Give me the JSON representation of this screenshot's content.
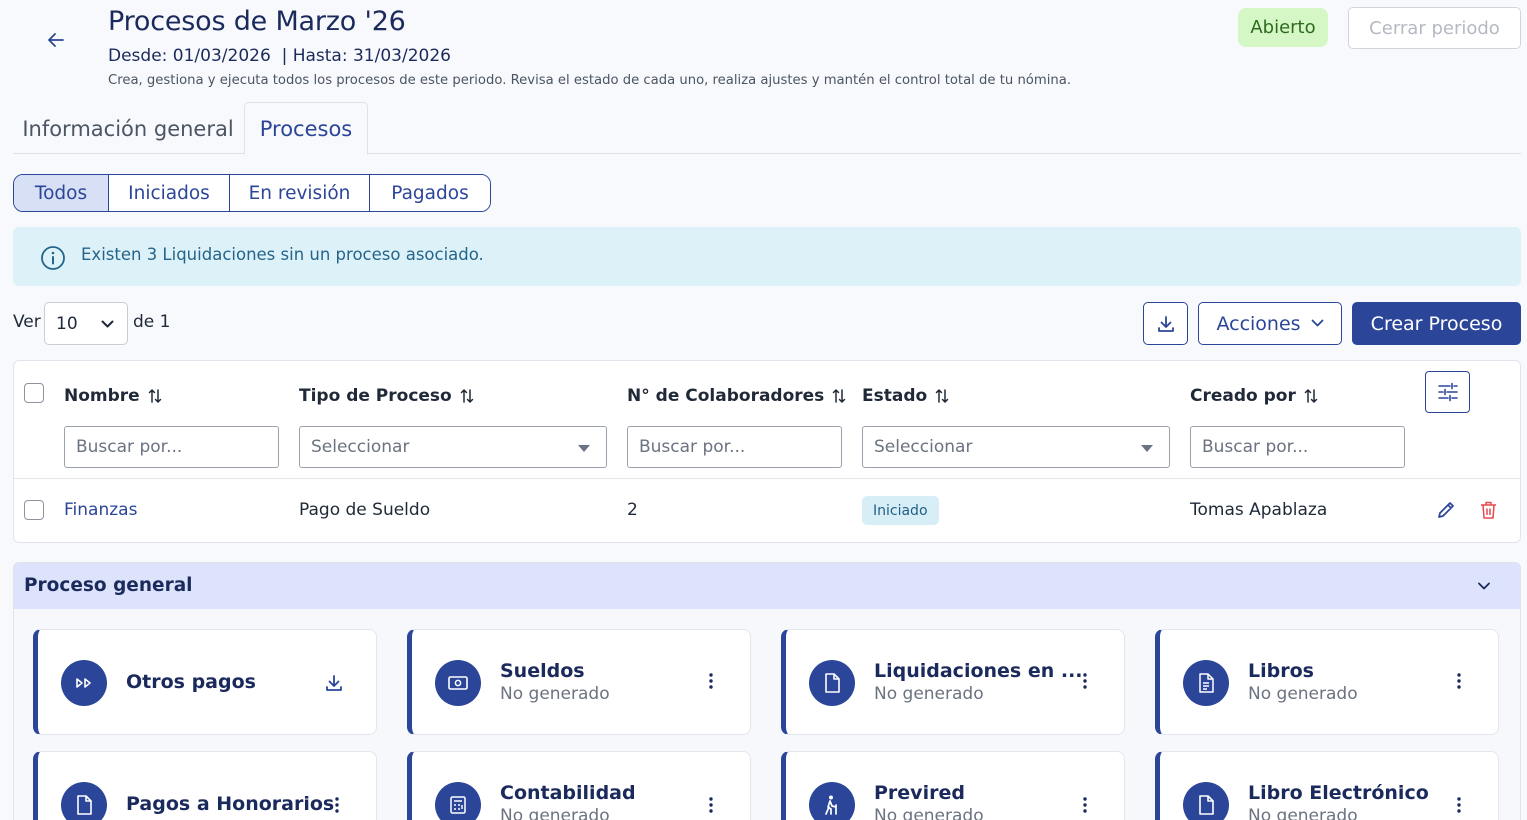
{
  "header": {
    "title": "Procesos de Marzo '26",
    "dates": "Desde: 01/03/2026  | Hasta: 31/03/2026",
    "description": "Crea, gestiona y ejecuta todos los procesos de este periodo. Revisa el estado de cada uno, realiza ajustes y mantén el control total de tu nómina.",
    "status_badge": "Abierto",
    "close_button": "Cerrar periodo"
  },
  "tabs": [
    {
      "label": "Información general",
      "active": false
    },
    {
      "label": "Procesos",
      "active": true
    }
  ],
  "filters": [
    {
      "label": "Todos",
      "active": true
    },
    {
      "label": "Iniciados",
      "active": false
    },
    {
      "label": "En revisión",
      "active": false
    },
    {
      "label": "Pagados",
      "active": false
    }
  ],
  "alert": {
    "text": "Existen 3 Liquidaciones sin un proceso asociado."
  },
  "pagination": {
    "ver_label": "Ver",
    "page_size": "10",
    "of_label": "de 1"
  },
  "toolbar": {
    "actions_label": "Acciones",
    "create_label": "Crear Proceso"
  },
  "table": {
    "columns": [
      "Nombre",
      "Tipo de Proceso",
      "N° de Colaboradores",
      "Estado",
      "Creado por"
    ],
    "filter_placeholders": [
      "Buscar por...",
      "Seleccionar",
      "Buscar por...",
      "Seleccionar",
      "Buscar por..."
    ],
    "rows": [
      {
        "nombre": "Finanzas",
        "tipo": "Pago de Sueldo",
        "colaboradores": "2",
        "estado": "Iniciado",
        "creado_por": "Tomas Apablaza"
      }
    ]
  },
  "section": {
    "title": "Proceso general",
    "cards": [
      {
        "name": "Otros pagos",
        "status": "",
        "icon": "fast-forward-icon",
        "action": "download-icon"
      },
      {
        "name": "Sueldos",
        "status": "No generado",
        "icon": "money-icon",
        "action": "more-vertical-icon"
      },
      {
        "name": "Liquidaciones en ...",
        "status": "No generado",
        "icon": "file-icon",
        "action": "more-vertical-icon"
      },
      {
        "name": "Libros",
        "status": "No generado",
        "icon": "file-text-icon",
        "action": "more-vertical-icon"
      },
      {
        "name": "Pagos a Honorarios",
        "status": "",
        "icon": "file-icon",
        "action": "more-vertical-icon"
      },
      {
        "name": "Contabilidad",
        "status": "No generado",
        "icon": "calculator-icon",
        "action": "more-vertical-icon"
      },
      {
        "name": "Previred",
        "status": "No generado",
        "icon": "elder-icon",
        "action": "more-vertical-icon"
      },
      {
        "name": "Libro Electrónico",
        "status": "No generado",
        "icon": "file-icon",
        "action": "more-vertical-icon"
      }
    ]
  },
  "colors": {
    "primary": "#2b4699",
    "badge_open_bg": "#d4f7c5",
    "alert_bg": "#ddf1f9",
    "danger": "#e5484d"
  }
}
